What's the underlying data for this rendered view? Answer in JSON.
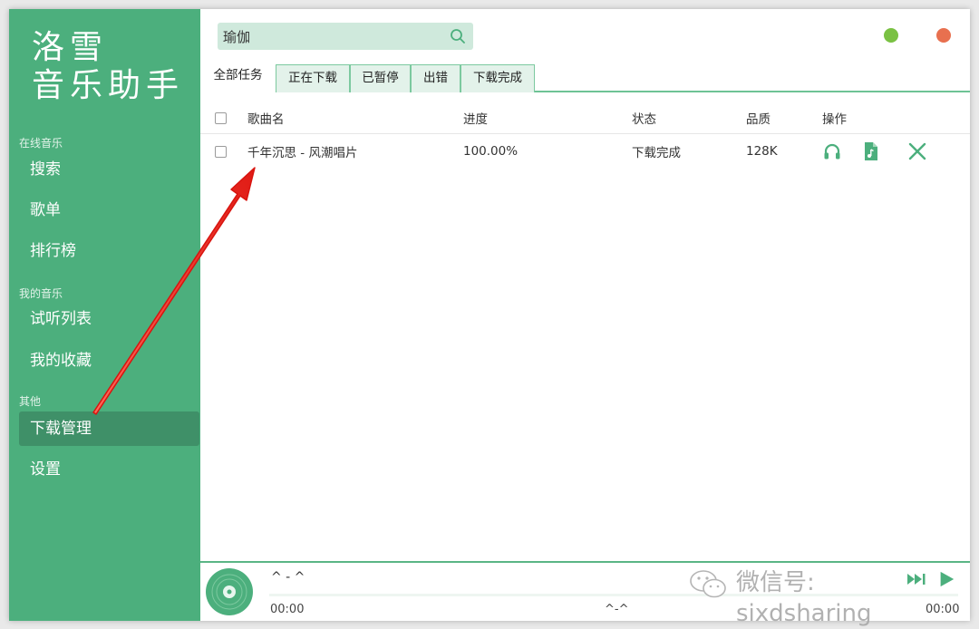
{
  "app": {
    "logo_line1": "洛雪",
    "logo_line2": "音乐助手",
    "window_controls": {
      "minimize_color": "#7ac143",
      "close_color": "#e8704f"
    }
  },
  "sidebar": {
    "sections": [
      {
        "label": "在线音乐",
        "items": [
          {
            "label": "搜索"
          },
          {
            "label": "歌单"
          },
          {
            "label": "排行榜"
          }
        ]
      },
      {
        "label": "我的音乐",
        "items": [
          {
            "label": "试听列表"
          },
          {
            "label": "我的收藏"
          }
        ]
      },
      {
        "label": "其他",
        "items": [
          {
            "label": "下载管理",
            "active": true
          },
          {
            "label": "设置"
          }
        ]
      }
    ]
  },
  "search": {
    "value": "瑜伽",
    "icon": "search-icon"
  },
  "tabs": [
    {
      "label": "全部任务",
      "active": true
    },
    {
      "label": "正在下载"
    },
    {
      "label": "已暂停"
    },
    {
      "label": "出错"
    },
    {
      "label": "下载完成"
    }
  ],
  "table": {
    "columns": [
      "歌曲名",
      "进度",
      "状态",
      "品质",
      "操作"
    ],
    "rows": [
      {
        "name": "千年沉思 - 风潮唱片",
        "progress": "100.00%",
        "status": "下载完成",
        "quality": "128K",
        "actions": [
          "headphones-icon",
          "music-file-icon",
          "close-icon"
        ]
      }
    ]
  },
  "player": {
    "title": "^ - ^",
    "time_current": "00:00",
    "center_label": "^-^",
    "time_total": "00:00",
    "accent": "#4caf7d"
  },
  "watermark": {
    "text": "微信号: sixdsharing"
  },
  "colors": {
    "brand": "#4caf7d",
    "brand_dark": "#3f9068",
    "arrow": "#e8231c"
  }
}
